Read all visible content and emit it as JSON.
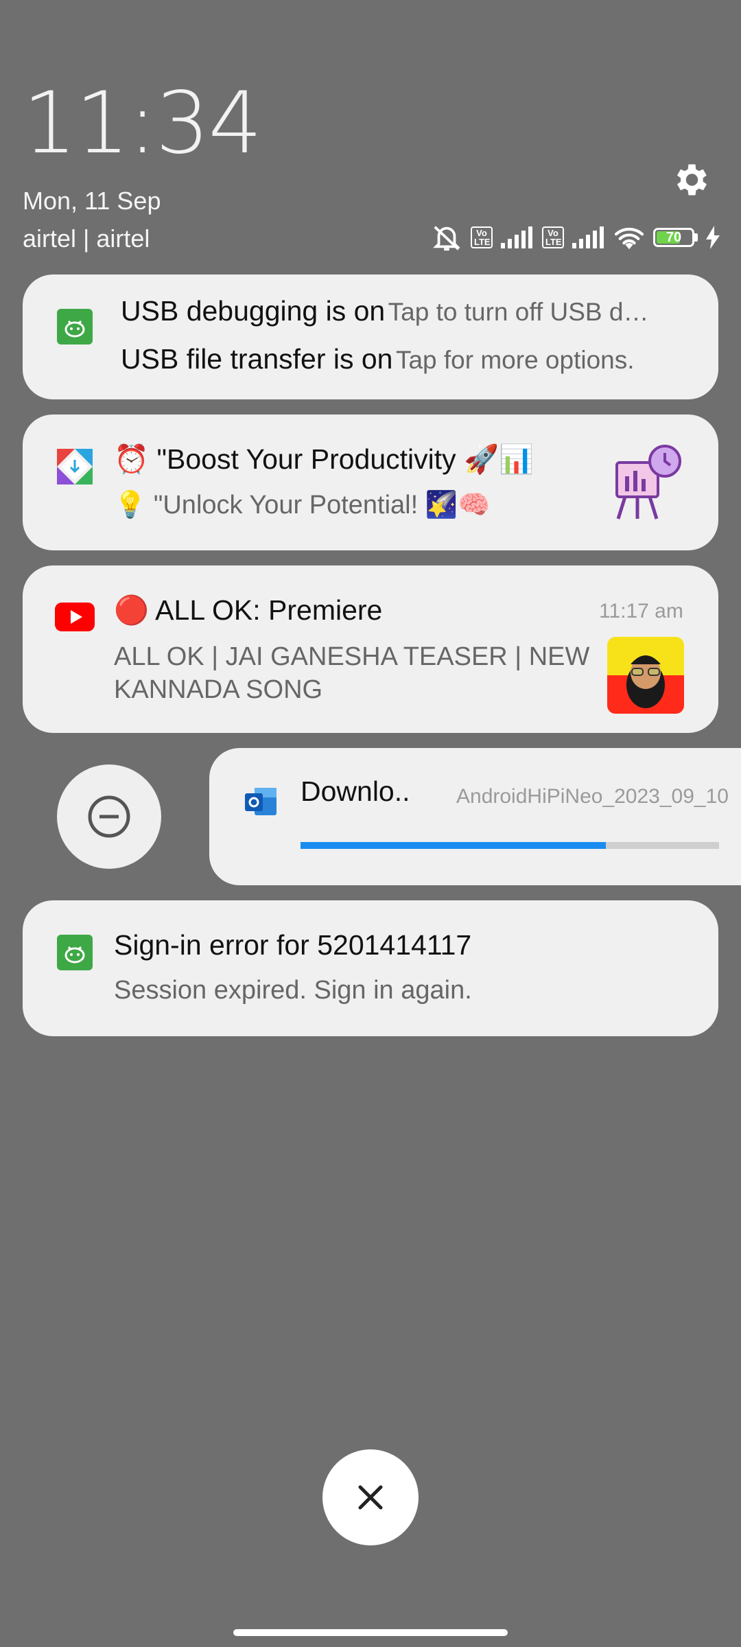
{
  "header": {
    "time": "11:34",
    "date": "Mon, 11 Sep",
    "carrier": "airtel | airtel",
    "volte1": "Vo LTE",
    "volte2": "Vo LTE",
    "battery_level": "70",
    "battery_fraction": 0.7,
    "icons": [
      "mute-bell-icon",
      "volte-icon",
      "signal-icon",
      "volte-icon",
      "signal-icon",
      "wifi-icon",
      "battery-icon",
      "charging-bolt-icon",
      "gear-icon"
    ]
  },
  "notifications": {
    "usb": {
      "title1": "USB debugging is on",
      "text1": "Tap to turn off USB d…",
      "title2": "USB file transfer is on",
      "text2": "Tap for more options."
    },
    "productivity": {
      "title": "⏰ \"Boost Your Productivity 🚀📊",
      "text": "💡 \"Unlock Your Potential! 🌠🧠"
    },
    "youtube": {
      "title": "🔴 ALL OK: Premiere",
      "time": "11:17 am",
      "text_line1": "ALL OK | JAI GANESHA TEASER | NEW",
      "text_line2": "KANNADA SONG"
    },
    "download": {
      "title": "Downlo..",
      "filename": "AndroidHiPiNeo_2023_09_10",
      "progress_fraction": 0.73
    },
    "signin": {
      "title": "Sign-in error for 5201414117",
      "text": "Session expired. Sign in again."
    }
  },
  "colors": {
    "background": "#6f6f6f",
    "card": "#f0f0f0",
    "progress": "#1a8cf0",
    "battery": "#6fd34b",
    "youtube_red": "#ff0000",
    "android_green": "#3ea846"
  }
}
